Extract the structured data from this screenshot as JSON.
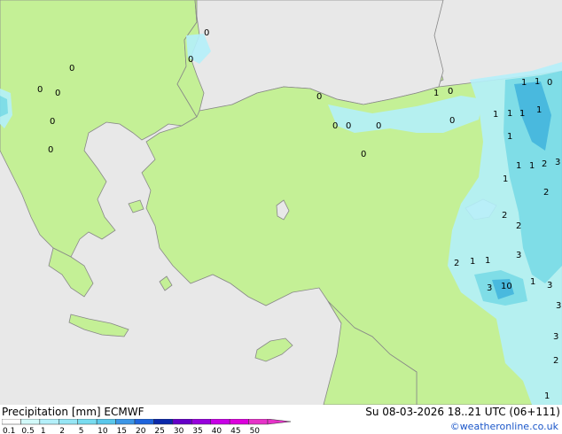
{
  "map": {
    "title_parts": {
      "product": "Precipitation",
      "unit": "[mm]",
      "model": "ECMWF"
    },
    "datetime": "Su 08-03-2026 18..21 UTC (06+111)",
    "credit": "©weatheronline.co.uk",
    "colors": {
      "sea": "#e8e8e8",
      "land": "#c4f096",
      "coast": "#888888",
      "precip_light": "#b4f0fa",
      "precip_mid": "#78dcf0",
      "precip_heavy": "#3cb4e6"
    },
    "legend": {
      "labels": [
        "0.1",
        "0.5",
        "1",
        "2",
        "5",
        "10",
        "15",
        "20",
        "25",
        "30",
        "35",
        "40",
        "45",
        "50"
      ],
      "colors": [
        "#ffffff",
        "#d2fafa",
        "#b4f0fa",
        "#96e6f5",
        "#78dcf0",
        "#5ac8eb",
        "#3c96e6",
        "#1e64dc",
        "#0a28aa",
        "#6400c8",
        "#9600dc",
        "#c800e6",
        "#dc00dc",
        "#e632c8"
      ]
    },
    "values": [
      "0",
      "0",
      "0",
      "0",
      "0",
      "0",
      "0",
      "0",
      "0",
      "0",
      "1",
      "0",
      "0",
      "1",
      "0",
      "0",
      "0",
      "1",
      "1",
      "1",
      "1",
      "1",
      "1",
      "1",
      "1",
      "1",
      "2",
      "2",
      "2",
      "2",
      "2",
      "3",
      "3",
      "3",
      "3",
      "3",
      "3",
      "10",
      "1",
      "1",
      "1",
      "1",
      "2"
    ]
  }
}
